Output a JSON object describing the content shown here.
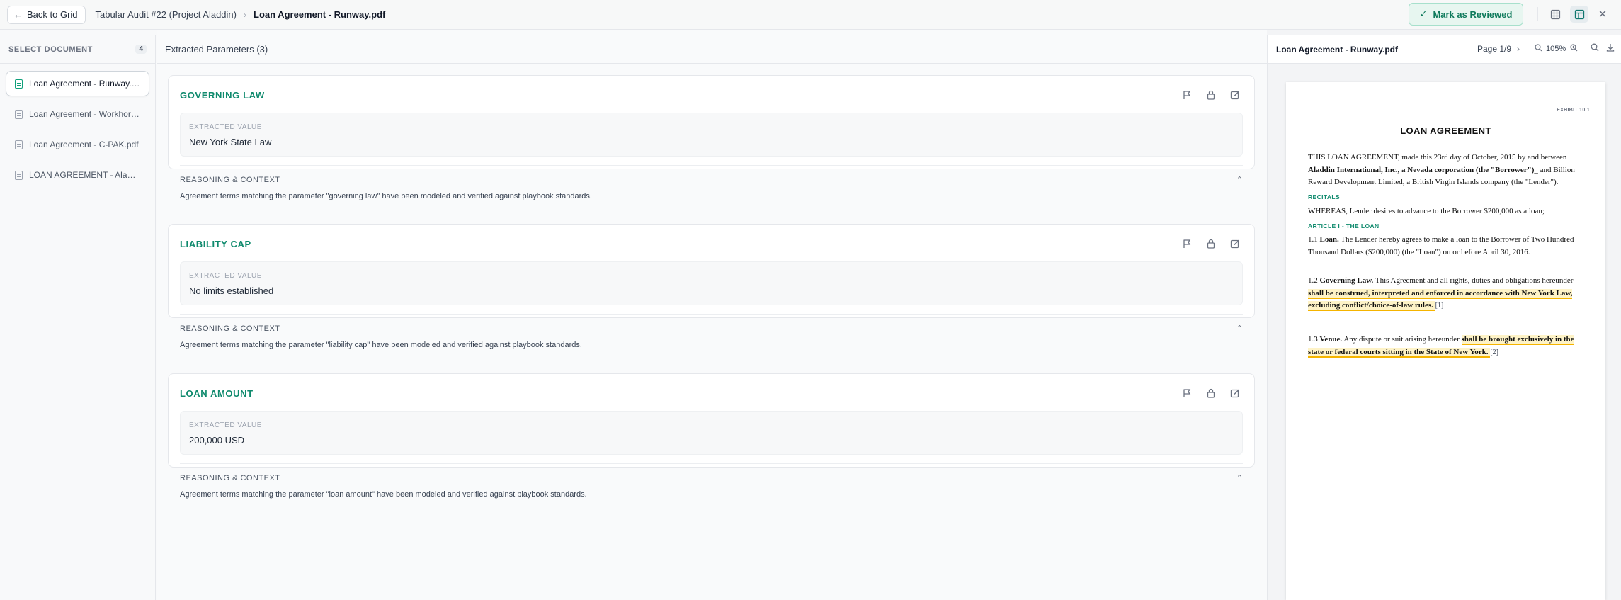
{
  "header": {
    "back_label": "Back to Grid",
    "project": "Tabular Audit #22 (Project Aladdin)",
    "file": "Loan Agreement - Runway.pdf",
    "review_label": "Mark as Reviewed"
  },
  "sidebar": {
    "title": "SELECT DOCUMENT",
    "count": "4",
    "items": [
      {
        "label": "Loan Agreement - Runway.pdf"
      },
      {
        "label": "Loan Agreement - Workhorse..."
      },
      {
        "label": "Loan Agreement - C-PAK.pdf"
      },
      {
        "label": "LOAN AGREEMENT - Aladdin..."
      }
    ]
  },
  "main": {
    "heading": "Extracted Parameters (3)",
    "value_label": "EXTRACTED VALUE",
    "reason_label": "REASONING & CONTEXT",
    "cards": [
      {
        "title": "GOVERNING LAW",
        "value": "New York State Law",
        "reason": "Agreement terms matching the parameter \"governing law\" have been modeled and verified against playbook standards."
      },
      {
        "title": "LIABILITY CAP",
        "value": "No limits established",
        "reason": "Agreement terms matching the parameter \"liability cap\" have been modeled and verified against playbook standards."
      },
      {
        "title": "LOAN AMOUNT",
        "value": "200,000 USD",
        "reason": "Agreement terms matching the parameter \"loan amount\" have been modeled and verified against playbook standards."
      }
    ]
  },
  "pdf": {
    "name": "Loan Agreement - Runway.pdf",
    "page": "Page 1/9",
    "zoom": "105%",
    "exhibit": "EXHIBIT 10.1",
    "title": "LOAN AGREEMENT",
    "intro_a": "THIS LOAN AGREEMENT, made this  23rd day of October, 2015  by and between ",
    "intro_bold": "Aladdin International, Inc., a Nevada corporation (the \"Borrower\")",
    "intro_b": "_ and Billion Reward Development Limited, a British Virgin Islands company (the \"Lender\").",
    "recitals": "RECITALS",
    "whereas": "WHEREAS, Lender desires to advance to the Borrower $200,000 as a loan;",
    "article": "ARTICLE I - THE LOAN",
    "s11_num": "1.1 ",
    "s11_head": "Loan.",
    "s11_text": " The Lender hereby agrees to make a loan to the Borrower of  Two Hundred Thousand Dollars ($200,000) (the \"Loan\")  on or before April 30, 2016.",
    "s12_num": "1.2 ",
    "s12_head": "Governing Law.",
    "s12_text": " This Agreement and all rights, duties and obligations hereunder ",
    "s12_hl": " shall be construed, interpreted and enforced in accordance with New York Law, excluding conflict/choice-of-law rules. ",
    "s12_ref": "[1]",
    "s13_num": "1.3 ",
    "s13_head": "Venue.",
    "s13_text": " Any dispute or suit arising hereunder ",
    "s13_hl": " shall be brought exclusively in the state or federal courts sitting in the State of New York. ",
    "s13_ref": "[2]"
  },
  "colors": {
    "accent": "#0f8a6d",
    "highlight": "#fef3c7",
    "highlight_border": "#f5b400"
  },
  "icons": [
    "arrow-left-icon",
    "chevron-right-icon",
    "check-icon",
    "grid-icon",
    "split-view-icon",
    "close-icon",
    "document-icon",
    "flag-icon",
    "lock-icon",
    "edit-icon",
    "chevron-up-icon",
    "zoom-out-icon",
    "zoom-in-icon",
    "search-icon",
    "download-icon"
  ]
}
